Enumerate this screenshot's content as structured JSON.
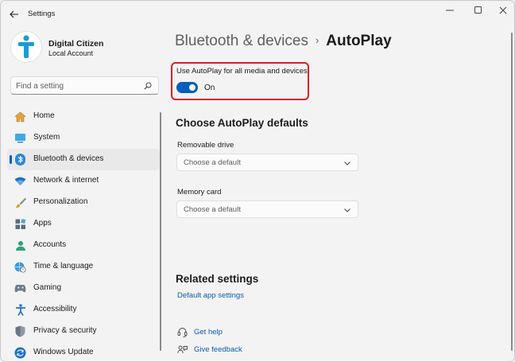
{
  "window": {
    "title": "Settings"
  },
  "user": {
    "name": "Digital Citizen",
    "account_type": "Local Account"
  },
  "search": {
    "placeholder": "Find a setting"
  },
  "sidebar": {
    "items": [
      {
        "label": "Home",
        "icon": "home-icon"
      },
      {
        "label": "System",
        "icon": "system-icon"
      },
      {
        "label": "Bluetooth & devices",
        "icon": "bluetooth-icon",
        "active": true
      },
      {
        "label": "Network & internet",
        "icon": "wifi-icon"
      },
      {
        "label": "Personalization",
        "icon": "brush-icon"
      },
      {
        "label": "Apps",
        "icon": "apps-icon"
      },
      {
        "label": "Accounts",
        "icon": "account-icon"
      },
      {
        "label": "Time & language",
        "icon": "globe-clock-icon"
      },
      {
        "label": "Gaming",
        "icon": "gamepad-icon"
      },
      {
        "label": "Accessibility",
        "icon": "accessibility-icon"
      },
      {
        "label": "Privacy & security",
        "icon": "shield-icon"
      },
      {
        "label": "Windows Update",
        "icon": "update-icon"
      }
    ]
  },
  "breadcrumb": {
    "parent": "Bluetooth & devices",
    "separator": "›",
    "current": "AutoPlay"
  },
  "autoplay": {
    "toggle_label": "Use AutoPlay for all media and devices",
    "toggle_state": "On",
    "enabled": true
  },
  "defaults": {
    "title": "Choose AutoPlay defaults",
    "removable_label": "Removable drive",
    "removable_value": "Choose a default",
    "memory_label": "Memory card",
    "memory_value": "Choose a default"
  },
  "related": {
    "title": "Related settings",
    "default_apps_link": "Default app settings"
  },
  "help": {
    "get_help": "Get help",
    "give_feedback": "Give feedback"
  },
  "colors": {
    "accent": "#005fb8",
    "highlight": "#e01b24",
    "link": "#0b5cad"
  }
}
